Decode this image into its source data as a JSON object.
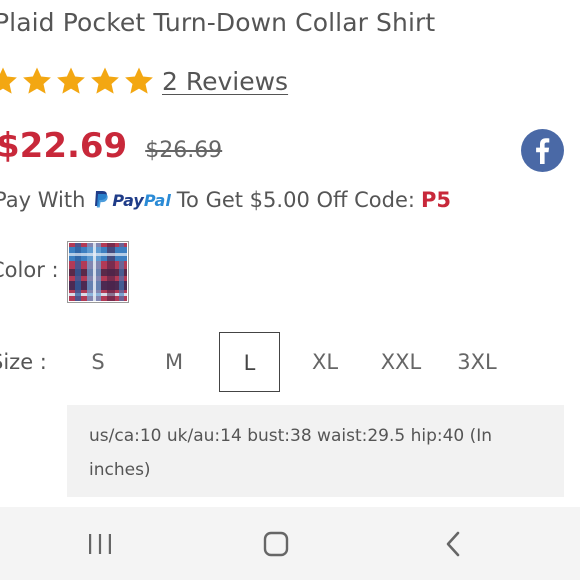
{
  "product": {
    "title": "Plaid Pocket Turn-Down Collar Shirt",
    "rating": 5,
    "reviews_label": "2 Reviews",
    "price": "$22.69",
    "original_price": "$26.69"
  },
  "promo": {
    "prefix": "Pay With",
    "paypal_logo_text_1": "Pay",
    "paypal_logo_text_2": "Pal",
    "middle": "To Get $5.00 Off Code:",
    "code": "P5"
  },
  "color": {
    "label": "Color :",
    "swatch_name": "plaid-swatch"
  },
  "size": {
    "label": "Size :",
    "options": [
      "S",
      "M",
      "L",
      "XL",
      "XXL",
      "3XL"
    ],
    "selected": "L",
    "info": "us/ca:10 uk/au:14 bust:38 waist:29.5 hip:40 (In inches)"
  },
  "colors": {
    "accent_red": "#c8283a",
    "star": "#f3a712",
    "facebook": "#4a69a6"
  },
  "icons": {
    "share": "facebook-icon",
    "nav_recent": "recent-apps-icon",
    "nav_home": "home-icon",
    "nav_back": "back-icon"
  }
}
